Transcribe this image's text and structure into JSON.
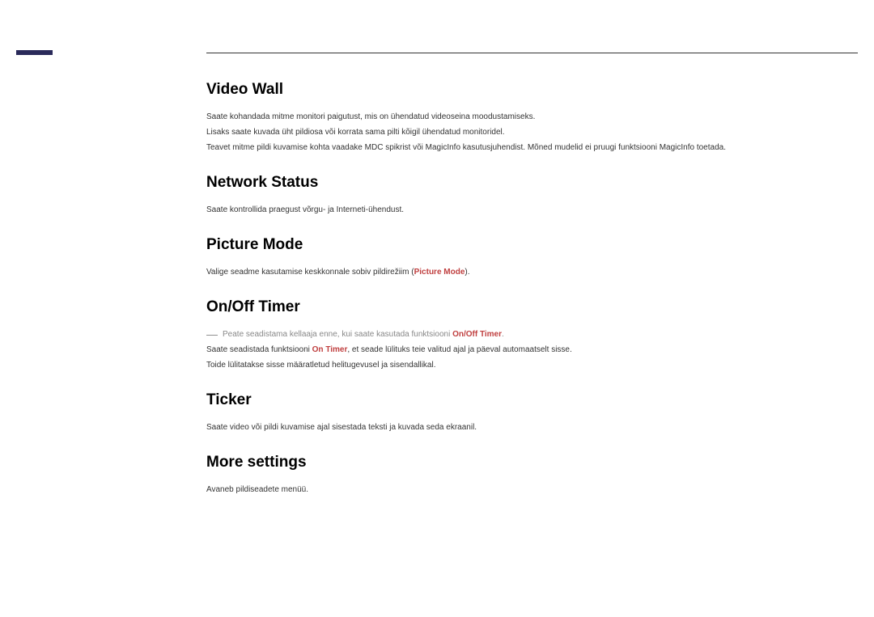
{
  "sections": {
    "videoWall": {
      "title": "Video Wall",
      "body1": "Saate kohandada mitme monitori paigutust, mis on ühendatud videoseina moodustamiseks.",
      "body2": "Lisaks saate kuvada üht pildiosa või korrata sama pilti kõigil ühendatud monitoridel.",
      "body3": "Teavet mitme pildi kuvamise kohta vaadake MDC spikrist või MagicInfo kasutusjuhendist. Mõned mudelid ei pruugi funktsiooni MagicInfo toetada."
    },
    "networkStatus": {
      "title": "Network Status",
      "body1": "Saate kontrollida praegust võrgu- ja Interneti-ühendust."
    },
    "pictureMode": {
      "title": "Picture Mode",
      "body1_pre": "Valige seadme kasutamise keskkonnale sobiv pildirežiim (",
      "body1_hl": "Picture Mode",
      "body1_post": ")."
    },
    "onOffTimer": {
      "title": "On/Off Timer",
      "note_pre": "Peate seadistama kellaaja enne, kui saate kasutada funktsiooni ",
      "note_hl": "On/Off Timer",
      "note_post": ".",
      "body2_pre": "Saate seadistada funktsiooni ",
      "body2_hl": "On Timer",
      "body2_post": ", et seade lülituks teie valitud ajal ja päeval automaatselt sisse.",
      "body3": "Toide lülitatakse sisse määratletud helitugevusel ja sisendallikal."
    },
    "ticker": {
      "title": "Ticker",
      "body1": "Saate video või pildi kuvamise ajal sisestada teksti ja kuvada seda ekraanil."
    },
    "moreSettings": {
      "title": "More settings",
      "body1": "Avaneb pildiseadete menüü."
    }
  }
}
